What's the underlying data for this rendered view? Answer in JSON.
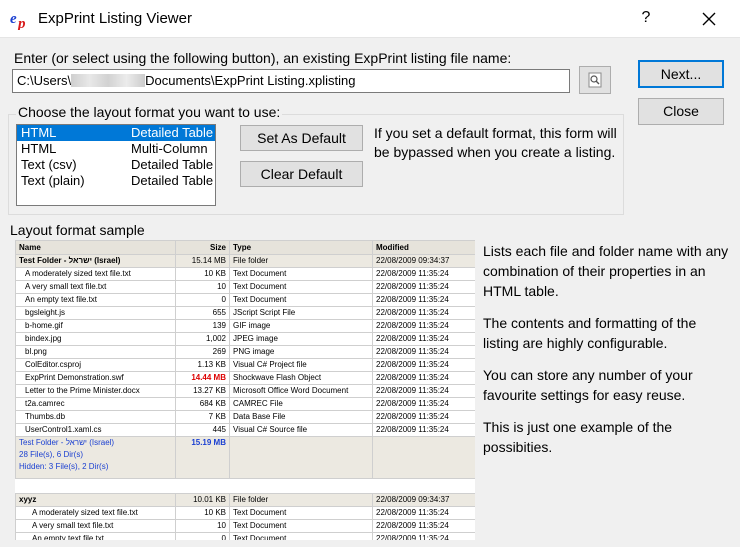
{
  "window": {
    "title": "ExpPrint Listing Viewer",
    "help": "?"
  },
  "prompt": "Enter (or select using the following button), an existing ExpPrint listing file name:",
  "path": {
    "prefix": "C:\\Users\\",
    "suffix": "Documents\\ExpPrint Listing.xplisting"
  },
  "buttons": {
    "next": "Next...",
    "close": "Close",
    "set_default": "Set As Default",
    "clear_default": "Clear Default"
  },
  "layout_group": {
    "label": "Choose the layout format you want to use:",
    "options": [
      {
        "format": "HTML",
        "style": "Detailed Table"
      },
      {
        "format": "HTML",
        "style": "Multi-Column"
      },
      {
        "format": "Text (csv)",
        "style": "Detailed Table"
      },
      {
        "format": "Text (plain)",
        "style": "Detailed Table"
      }
    ],
    "note": "If you set a default format, this form will be bypassed when you create a listing."
  },
  "sample": {
    "label": "Layout format sample",
    "headers": [
      "Name",
      "Size",
      "Type",
      "Modified"
    ],
    "folder1": {
      "name": "Test Folder - ישראל (Israel)",
      "size": "15.14 MB",
      "type": "File folder",
      "modified": "22/08/2009 09:34:37"
    },
    "rows1": [
      [
        "A moderately sized text file.txt",
        "10 KB",
        "Text Document",
        "22/08/2009 11:35:24"
      ],
      [
        "A very small text file.txt",
        "10",
        "Text Document",
        "22/08/2009 11:35:24"
      ],
      [
        "An empty text file.txt",
        "0",
        "Text Document",
        "22/08/2009 11:35:24"
      ],
      [
        "bgsleight.js",
        "655",
        "JScript Script File",
        "22/08/2009 11:35:24"
      ],
      [
        "b-home.gif",
        "139",
        "GIF image",
        "22/08/2009 11:35:24"
      ],
      [
        "bindex.jpg",
        "1,002",
        "JPEG image",
        "22/08/2009 11:35:24"
      ],
      [
        "bl.png",
        "269",
        "PNG image",
        "22/08/2009 11:35:24"
      ],
      [
        "ColEditor.csproj",
        "1.13 KB",
        "Visual C# Project file",
        "22/08/2009 11:35:24"
      ],
      [
        "ExpPrint Demonstration.swf",
        "14.44 MB",
        "Shockwave Flash Object",
        "22/08/2009 11:35:24"
      ],
      [
        "Letter to the Prime Minister.docx",
        "13.27 KB",
        "Microsoft Office Word Document",
        "22/08/2009 11:35:24"
      ],
      [
        "t2a.camrec",
        "684 KB",
        "CAMREC File",
        "22/08/2009 11:35:24"
      ],
      [
        "Thumbs.db",
        "7 KB",
        "Data Base File",
        "22/08/2009 11:35:24"
      ],
      [
        "UserControl1.xaml.cs",
        "445",
        "Visual C# Source file",
        "22/08/2009 11:35:24"
      ]
    ],
    "summary": {
      "line1": "Test Folder - ישראל (Israel)",
      "line2": "28 File(s), 6 Dir(s)",
      "line3": "Hidden: 3 File(s), 2 Dir(s)",
      "size": "15.19 MB"
    },
    "folder2": {
      "name": "xyyz",
      "size": "10.01 KB",
      "type": "File folder",
      "modified": "22/08/2009 09:34:37"
    },
    "rows2": [
      [
        "A moderately sized text file.txt",
        "10 KB",
        "Text Document",
        "22/08/2009 11:35:24"
      ],
      [
        "A very small text file.txt",
        "10",
        "Text Document",
        "22/08/2009 11:35:24"
      ],
      [
        "An empty text file.txt",
        "0",
        "Text Document",
        "22/08/2009 11:35:24"
      ]
    ]
  },
  "description": [
    "Lists each file and folder name with any combination of their properties in an HTML table.",
    "The contents and formatting of the listing are highly configurable.",
    "You can store any number of your favourite settings for easy reuse.",
    "This is just one example of the possibities."
  ]
}
